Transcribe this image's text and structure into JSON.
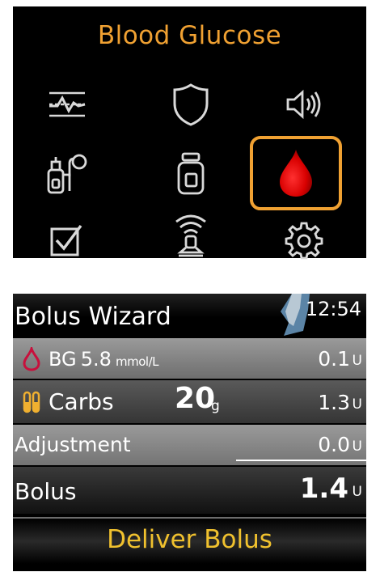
{
  "menu": {
    "title": "Blood Glucose",
    "accent": "#f0a132",
    "items": [
      {
        "icon": "sensor-graph-icon"
      },
      {
        "icon": "shield-icon"
      },
      {
        "icon": "speaker-icon"
      },
      {
        "icon": "pump-infusion-icon"
      },
      {
        "icon": "reservoir-icon"
      },
      {
        "icon": "blood-drop-icon",
        "selected": true
      },
      {
        "icon": "checkbox-icon"
      },
      {
        "icon": "wireless-connection-icon"
      },
      {
        "icon": "gear-icon"
      }
    ]
  },
  "wizard": {
    "title": "Bolus Wizard",
    "time": "12:54",
    "bg": {
      "label": "BG",
      "value": "5.8",
      "unit": "mmol/L",
      "insulin": "0.1",
      "insulin_unit": "U"
    },
    "carbs": {
      "label": "Carbs",
      "value": "20",
      "unit": "g",
      "insulin": "1.3",
      "insulin_unit": "U"
    },
    "adjustment": {
      "label": "Adjustment",
      "insulin": "0.0",
      "insulin_unit": "U"
    },
    "bolus": {
      "label": "Bolus",
      "insulin": "1.4",
      "insulin_unit": "U"
    },
    "deliver_label": "Deliver Bolus",
    "deliver_color": "#f0c12e"
  }
}
